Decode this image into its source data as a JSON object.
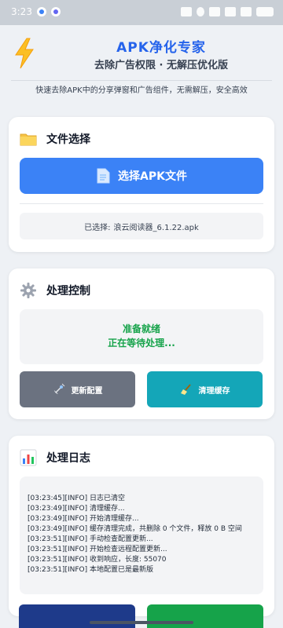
{
  "status_bar": {
    "time": "3:23"
  },
  "header": {
    "icon": "lightning-icon",
    "title": "APK净化专家",
    "subtitle": "去除广告权限 · 无解压优化版",
    "description": "快速去除APK中的分享弹窗和广告组件，无需解压，安全高效"
  },
  "file_card": {
    "icon": "folder-icon",
    "title": "文件选择",
    "select_button_icon": "document-icon",
    "select_button_label": "选择APK文件",
    "selected_prefix": "已选择:",
    "selected_file": "浪云阅读器_6.1.22.apk"
  },
  "control_card": {
    "icon": "gear-icon",
    "title": "处理控制",
    "status_line1": "准备就绪",
    "status_line2": "正在等待处理...",
    "update_button_icon": "satellite-icon",
    "update_button_label": "更新配置",
    "clear_button_icon": "broom-icon",
    "clear_button_label": "清理缓存"
  },
  "log_card": {
    "icon": "bar-chart-icon",
    "title": "处理日志",
    "lines": [
      "[03:23:45][INFO] 日志已清空",
      "[03:23:49][INFO] 清理缓存...",
      "[03:23:49][INFO] 开始清理缓存...",
      "[03:23:49][INFO] 缓存清理完成，共删除 0 个文件，释放 0 B 空间",
      "[03:23:51][INFO] 手动检查配置更新...",
      "[03:23:51][INFO] 开始检查远程配置更新...",
      "[03:23:51][INFO] 收到响应，长度: 55070",
      "[03:23:51][INFO] 本地配置已是最新版"
    ]
  },
  "colors": {
    "accent": "#3b82f6",
    "title": "#2563eb",
    "ready": "#16a34a",
    "update_button": "#6b7280",
    "clear_button": "#14a6b8"
  }
}
